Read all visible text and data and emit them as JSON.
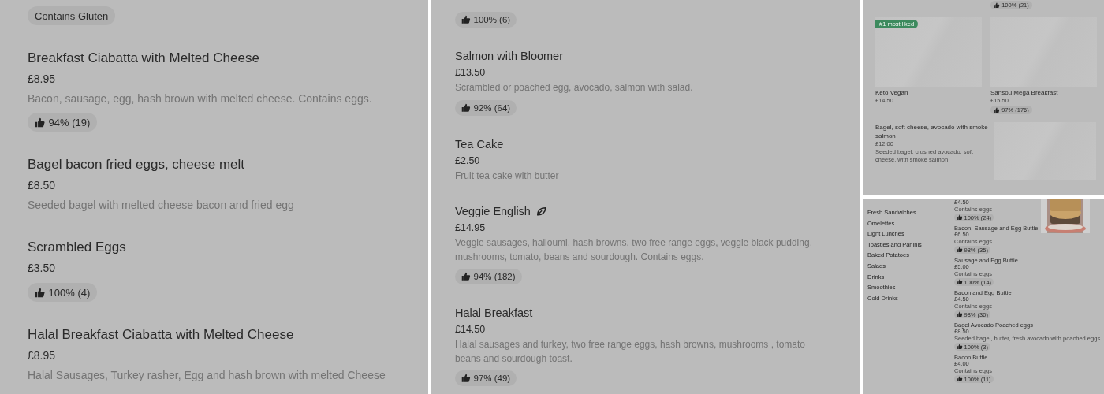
{
  "panels": [
    {
      "kind": "list",
      "items": [
        {
          "tags": [
            "Contains Gluten"
          ]
        },
        {
          "name": "Breakfast Ciabatta with Melted Cheese",
          "price": "£8.95",
          "description": "Bacon, sausage, egg, hash brown with melted cheese. Contains eggs.",
          "rating": "94% (19)"
        },
        {
          "name": "Bagel bacon fried eggs, cheese melt",
          "price": "£8.50",
          "description": "Seeded bagel with melted cheese bacon and fried egg"
        },
        {
          "name": "Scrambled Eggs",
          "price": "£3.50",
          "rating": "100% (4)"
        },
        {
          "name": "Halal Breakfast Ciabatta with Melted Cheese",
          "price": "£8.95",
          "description": "Halal Sausages, Turkey rasher, Egg and hash brown with melted Cheese"
        }
      ]
    },
    {
      "kind": "compactlist",
      "items": [
        {
          "rating": "100% (6)"
        },
        {
          "name": "Salmon with Bloomer",
          "price": "£13.50",
          "description": "Scrambled or poached egg, avocado, salmon with salad.",
          "rating": "92% (64)"
        },
        {
          "name": "Tea Cake",
          "price": "£2.50",
          "description": "Fruit tea cake with butter"
        },
        {
          "name": "Veggie English",
          "plant_based": true,
          "price": "£14.95",
          "description": "Veggie sausages, halloumi, hash browns, two free range eggs, veggie black pudding, mushrooms, tomato, beans and sourdough. Contains eggs.",
          "rating": "94% (182)"
        },
        {
          "name": "Halal Breakfast",
          "price": "£14.50",
          "description": "Halal sausages and turkey, two free range eggs, hash browns, mushrooms , tomato beans and sourdough toast.",
          "rating": "97% (49)"
        }
      ]
    },
    {
      "kind": "grid",
      "rating": "100% (21)",
      "cards": [
        {
          "badge": "#1 most liked",
          "name": "Keto Vegan",
          "price": "£14.50"
        },
        {
          "name": "Sansou Mega Breakfast",
          "price": "£15.50",
          "rating": "97% (176)"
        }
      ],
      "featured": {
        "name": "Bagel, soft cheese, avocado with smoke salmon",
        "price": "£12.00",
        "description": "Seeded bagel, crushed avocado, soft cheese, with smoke salmon"
      }
    },
    {
      "kind": "category",
      "categories": [
        "Fresh Sandwiches",
        "Omelettes",
        "Light Lunches",
        "Toasties and Paninis",
        "Baked Potatoes",
        "Salads",
        "Drinks",
        "Smoothies",
        "Cold Drinks"
      ],
      "items": [
        {
          "price": "£4.50",
          "description": "Contains eggs",
          "rating": "100% (24)"
        },
        {
          "name": "Bacon, Sausage and Egg Buttie",
          "price": "£6.50",
          "description": "Contains eggs",
          "rating": "98% (35)"
        },
        {
          "name": "Sausage and Egg Buttie",
          "price": "£5.00",
          "description": "Contains eggs",
          "rating": "100% (14)"
        },
        {
          "name": "Bacon and Egg Buttie",
          "price": "£4.50",
          "description": "Contains eggs",
          "rating": "98% (30)"
        },
        {
          "name": "Bagel Avocado Poached eggs",
          "price": "£8.50",
          "description": "Seeded bagel, butter, fresh avocado with poached eggs",
          "rating": "100% (3)"
        },
        {
          "name": "Bacon Buttie",
          "price": "£4.00",
          "description": "Contains eggs",
          "rating": "100% (11)"
        }
      ]
    }
  ]
}
